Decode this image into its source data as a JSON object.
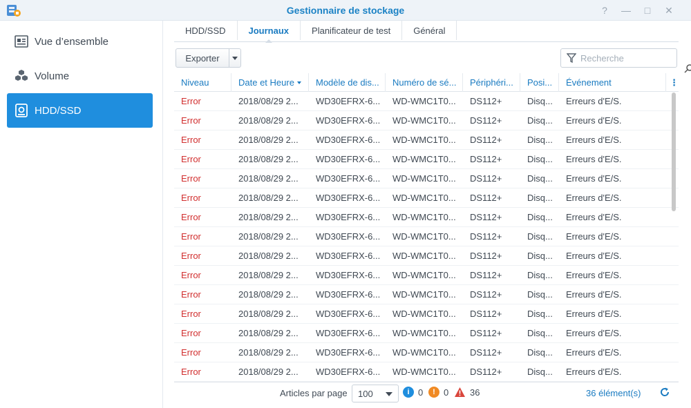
{
  "window": {
    "title": "Gestionnaire de stockage",
    "help": "?",
    "minimize": "—",
    "maximize": "□",
    "close": "✕"
  },
  "sidebar": {
    "items": [
      {
        "label": "Vue d’ensemble",
        "icon": "overview-icon"
      },
      {
        "label": "Volume",
        "icon": "volume-cubes-icon"
      },
      {
        "label": "HDD/SSD",
        "icon": "disk-icon",
        "active": true
      }
    ]
  },
  "tabs": [
    {
      "label": "HDD/SSD"
    },
    {
      "label": "Journaux",
      "active": true
    },
    {
      "label": "Planificateur de test"
    },
    {
      "label": "Général"
    }
  ],
  "toolbar": {
    "export_label": "Exporter",
    "search_placeholder": "Recherche"
  },
  "table": {
    "columns": [
      "Niveau",
      "Date et Heure",
      "Modèle de dis...",
      "Numéro de sé...",
      "Périphéri...",
      "Posi...",
      "Événement",
      "⋮"
    ],
    "rows": [
      [
        "Error",
        "2018/08/29 2...",
        "WD30EFRX-6...",
        "WD-WMC1T0...",
        "DS112+",
        "Disq...",
        "Erreurs d'E/S."
      ],
      [
        "Error",
        "2018/08/29 2...",
        "WD30EFRX-6...",
        "WD-WMC1T0...",
        "DS112+",
        "Disq...",
        "Erreurs d'E/S."
      ],
      [
        "Error",
        "2018/08/29 2...",
        "WD30EFRX-6...",
        "WD-WMC1T0...",
        "DS112+",
        "Disq...",
        "Erreurs d'E/S."
      ],
      [
        "Error",
        "2018/08/29 2...",
        "WD30EFRX-6...",
        "WD-WMC1T0...",
        "DS112+",
        "Disq...",
        "Erreurs d'E/S."
      ],
      [
        "Error",
        "2018/08/29 2...",
        "WD30EFRX-6...",
        "WD-WMC1T0...",
        "DS112+",
        "Disq...",
        "Erreurs d'E/S."
      ],
      [
        "Error",
        "2018/08/29 2...",
        "WD30EFRX-6...",
        "WD-WMC1T0...",
        "DS112+",
        "Disq...",
        "Erreurs d'E/S."
      ],
      [
        "Error",
        "2018/08/29 2...",
        "WD30EFRX-6...",
        "WD-WMC1T0...",
        "DS112+",
        "Disq...",
        "Erreurs d'E/S."
      ],
      [
        "Error",
        "2018/08/29 2...",
        "WD30EFRX-6...",
        "WD-WMC1T0...",
        "DS112+",
        "Disq...",
        "Erreurs d'E/S."
      ],
      [
        "Error",
        "2018/08/29 2...",
        "WD30EFRX-6...",
        "WD-WMC1T0...",
        "DS112+",
        "Disq...",
        "Erreurs d'E/S."
      ],
      [
        "Error",
        "2018/08/29 2...",
        "WD30EFRX-6...",
        "WD-WMC1T0...",
        "DS112+",
        "Disq...",
        "Erreurs d'E/S."
      ],
      [
        "Error",
        "2018/08/29 2...",
        "WD30EFRX-6...",
        "WD-WMC1T0...",
        "DS112+",
        "Disq...",
        "Erreurs d'E/S."
      ],
      [
        "Error",
        "2018/08/29 2...",
        "WD30EFRX-6...",
        "WD-WMC1T0...",
        "DS112+",
        "Disq...",
        "Erreurs d'E/S."
      ],
      [
        "Error",
        "2018/08/29 2...",
        "WD30EFRX-6...",
        "WD-WMC1T0...",
        "DS112+",
        "Disq...",
        "Erreurs d'E/S."
      ],
      [
        "Error",
        "2018/08/29 2...",
        "WD30EFRX-6...",
        "WD-WMC1T0...",
        "DS112+",
        "Disq...",
        "Erreurs d'E/S."
      ],
      [
        "Error",
        "2018/08/29 2...",
        "WD30EFRX-6...",
        "WD-WMC1T0...",
        "DS112+",
        "Disq...",
        "Erreurs d'E/S."
      ]
    ]
  },
  "footer": {
    "per_page_label": "Articles par page",
    "per_page_value": "100",
    "info_count": "0",
    "warning_count": "0",
    "error_count": "36",
    "total_label": "36 élément(s)"
  },
  "colors": {
    "accent": "#1f8ede",
    "header_text": "#1a7bc1",
    "error_text": "#d12e2e",
    "info": "#1f8ede",
    "warning": "#f08a24",
    "error": "#d9453b"
  }
}
